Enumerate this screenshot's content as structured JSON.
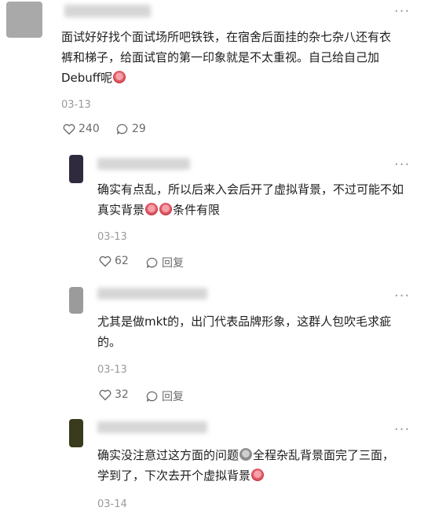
{
  "comments": [
    {
      "text": "面试好好找个面试场所吧铁铁，在宿舍后面挂的杂七杂八还有衣裤和梯子，给面试官的第一印象就是不太重视。自己给自己加Debuff呢",
      "date": "03-13",
      "likes": "240",
      "replies": "29"
    },
    {
      "text_part1": "确实有点乱，所以后来入会后开了虚拟背景，不过可能不如真实背景",
      "text_part2": "条件有限",
      "date": "03-13",
      "likes": "62",
      "reply_label": "回复"
    },
    {
      "text": "尤其是做mkt的，出门代表品牌形象，这群人包吹毛求疵的。",
      "date": "03-13",
      "likes": "32",
      "reply_label": "回复"
    },
    {
      "text_part1": "确实没注意过这方面的问题",
      "text_part2": "全程杂乱背景面完了三面，学到了，下次去开个虚拟背景",
      "date": "03-14"
    }
  ],
  "icons": [
    "more-icon",
    "heart-icon",
    "comment-icon",
    "emoji-icon"
  ]
}
